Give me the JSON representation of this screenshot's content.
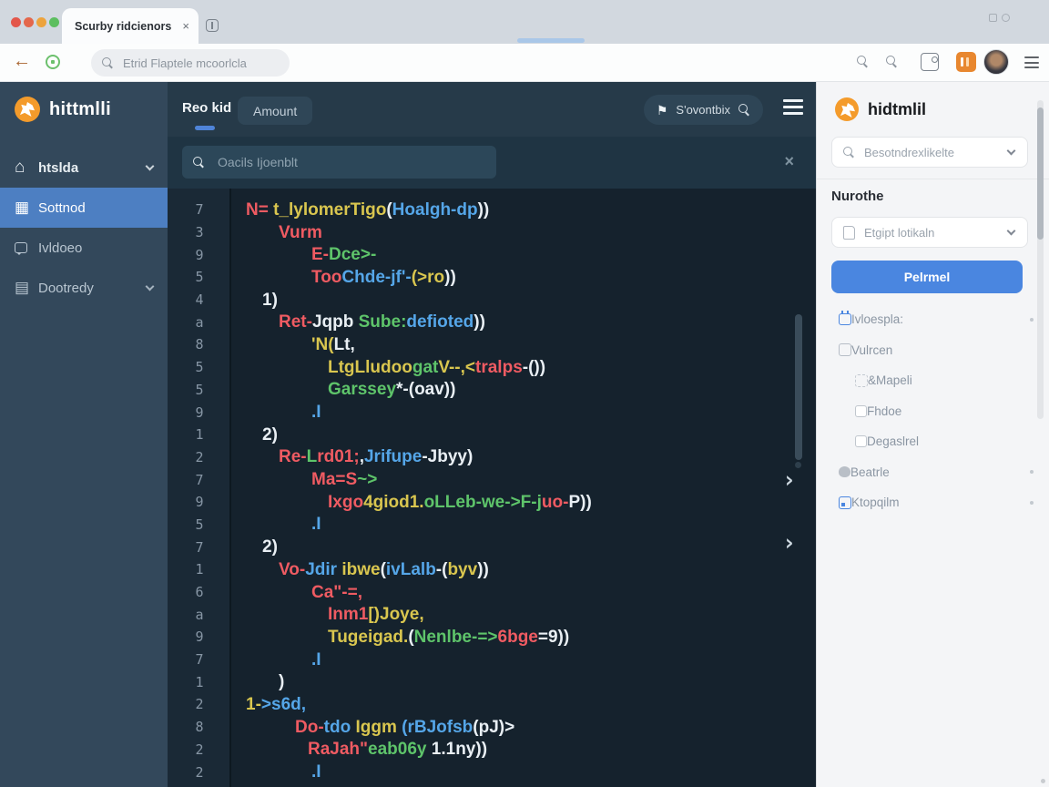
{
  "browser": {
    "tab_title": "Scurby ridcienors",
    "address_placeholder": "Etrid Flaptele mcoorlcla"
  },
  "sidebar": {
    "logo_text": "hittmlli",
    "items": [
      {
        "name": "home",
        "icon": "home",
        "label": "htslda",
        "chevron": true,
        "active": false
      },
      {
        "name": "dashboard",
        "icon": "grid",
        "label": "Sottnod",
        "chevron": false,
        "active": true
      },
      {
        "name": "videos",
        "icon": "chat",
        "label": "Ivldoeo",
        "chevron": false,
        "active": false
      },
      {
        "name": "library",
        "icon": "book",
        "label": "Dootredy",
        "chevron": true,
        "active": false
      }
    ]
  },
  "editor": {
    "active_tab": "Reo kid",
    "secondary_button": "Amount",
    "action_pill": "S'ovontbix",
    "search_placeholder": "Oacils Ijoenblt",
    "close_glyph": "×"
  },
  "code": {
    "lines": [
      {
        "n": "7",
        "i": 0,
        "s": [
          [
            "r",
            "N= "
          ],
          [
            "y",
            "t_lylomerTigo"
          ],
          [
            "w",
            "("
          ],
          [
            "b",
            "Hoalgh-dp"
          ],
          [
            "w",
            "))"
          ]
        ]
      },
      {
        "n": "3",
        "i": 36,
        "s": [
          [
            "r",
            "Vurm"
          ]
        ]
      },
      {
        "n": "9",
        "i": 72,
        "s": [
          [
            "r",
            "E-"
          ],
          [
            "g",
            "Dce>-"
          ]
        ]
      },
      {
        "n": "5",
        "i": 72,
        "s": [
          [
            "r",
            "Too"
          ],
          [
            "b",
            "Chde-jf'-"
          ],
          [
            "y",
            "(>ro"
          ],
          [
            "w",
            "))"
          ]
        ]
      },
      {
        "n": "4",
        "i": 18,
        "s": [
          [
            "w",
            "1)"
          ]
        ]
      },
      {
        "n": "a",
        "i": 36,
        "s": [
          [
            "r",
            "Ret-"
          ],
          [
            "w",
            "Jqpb "
          ],
          [
            "g",
            "Sube:"
          ],
          [
            "b",
            "defioted"
          ],
          [
            "w",
            "))"
          ]
        ]
      },
      {
        "n": "8",
        "i": 72,
        "s": [
          [
            "y",
            "'N("
          ],
          [
            "w",
            "Lt,"
          ]
        ]
      },
      {
        "n": "5",
        "i": 90,
        "s": [
          [
            "y",
            "LtgLludoo"
          ],
          [
            "g",
            "gat"
          ],
          [
            "y",
            "V--,<"
          ],
          [
            "r",
            "tralps"
          ],
          [
            "w",
            "-())"
          ]
        ]
      },
      {
        "n": "5",
        "i": 90,
        "s": [
          [
            "g",
            "Garssey"
          ],
          [
            "w",
            "*-(oav))"
          ]
        ]
      },
      {
        "n": "9",
        "i": 72,
        "s": [
          [
            "b",
            ".I"
          ]
        ]
      },
      {
        "n": "1",
        "i": 18,
        "s": [
          [
            "w",
            "2)"
          ]
        ]
      },
      {
        "n": "2",
        "i": 36,
        "s": [
          [
            "r",
            "Re-"
          ],
          [
            "g",
            "L"
          ],
          [
            "r",
            "rd01;"
          ],
          [
            "w",
            ","
          ],
          [
            "b",
            "Jrifupe"
          ],
          [
            "w",
            "-Jbyy)"
          ]
        ]
      },
      {
        "n": "7",
        "i": 72,
        "s": [
          [
            "r",
            "Ma=S"
          ],
          [
            "g",
            "~>"
          ]
        ]
      },
      {
        "n": "9",
        "i": 90,
        "s": [
          [
            "r",
            "Ixgo"
          ],
          [
            "y",
            "4giod1."
          ],
          [
            "g",
            "oLLeb-we->F-j"
          ],
          [
            "r",
            "uo-"
          ],
          [
            "w",
            "P))"
          ]
        ]
      },
      {
        "n": "5",
        "i": 72,
        "s": [
          [
            "b",
            ".I"
          ]
        ]
      },
      {
        "n": "7",
        "i": 18,
        "s": [
          [
            "w",
            "2)"
          ]
        ]
      },
      {
        "n": "1",
        "i": 36,
        "s": [
          [
            "r",
            "Vo-"
          ],
          [
            "b",
            "Jdir "
          ],
          [
            "y",
            "ibwe"
          ],
          [
            "w",
            "("
          ],
          [
            "b",
            "ivLalb"
          ],
          [
            "w",
            "-("
          ],
          [
            "y",
            "byv"
          ],
          [
            "w",
            "))"
          ]
        ]
      },
      {
        "n": "6",
        "i": 72,
        "s": [
          [
            "r",
            "Ca\"-=,"
          ]
        ]
      },
      {
        "n": "a",
        "i": 90,
        "s": [
          [
            "r",
            "Inm1"
          ],
          [
            "y",
            "[)Joye,"
          ]
        ]
      },
      {
        "n": "9",
        "i": 90,
        "s": [
          [
            "y",
            "Tugeigad."
          ],
          [
            "w",
            "("
          ],
          [
            "g",
            "Nenlbe-=>"
          ],
          [
            "r",
            "6bge"
          ],
          [
            "w",
            "=9))"
          ]
        ]
      },
      {
        "n": "7",
        "i": 72,
        "s": [
          [
            "b",
            ".I"
          ]
        ]
      },
      {
        "n": "1",
        "i": 36,
        "s": [
          [
            "w",
            ")"
          ]
        ]
      },
      {
        "n": "2",
        "i": 0,
        "s": [
          [
            "y",
            "1-"
          ],
          [
            "b",
            ">s6d,"
          ]
        ]
      },
      {
        "n": "8",
        "i": 54,
        "s": [
          [
            "r",
            "Do-"
          ],
          [
            "b",
            "tdo "
          ],
          [
            "y",
            "Iggm "
          ],
          [
            "b",
            "(rBJofsb"
          ],
          [
            "w",
            "(pJ)>"
          ]
        ]
      },
      {
        "n": "2",
        "i": 68,
        "s": [
          [
            "r",
            "RaJah\""
          ],
          [
            "g",
            "eab06y "
          ],
          [
            "w",
            "1.1ny))"
          ]
        ]
      },
      {
        "n": "2",
        "i": 72,
        "s": [
          [
            "b",
            ".I"
          ]
        ]
      }
    ]
  },
  "panel": {
    "logo_text": "hidtmlil",
    "search_placeholder": "Besotndrexlikelte",
    "section_label": "Nurothe",
    "dropdown_value": "Etgipt lotikaln",
    "primary_button": "Pelrmel",
    "items": [
      {
        "name": "templates",
        "icon": "cal",
        "label": "Ivloespla:",
        "indent": 0,
        "dot": true
      },
      {
        "name": "screen",
        "icon": "sq",
        "label": "Vulrcen",
        "indent": 0,
        "dot": false
      },
      {
        "name": "wrapper",
        "icon": "sqd",
        "label": "&Mapeli",
        "indent": 1,
        "dot": false
      },
      {
        "name": "shadow",
        "icon": "chk",
        "label": "Fhdoe",
        "indent": 1,
        "dot": false
      },
      {
        "name": "details",
        "icon": "chk",
        "label": "Degaslrel",
        "indent": 1,
        "dot": false
      },
      {
        "name": "beastie",
        "icon": "blob",
        "label": "Beatrle",
        "indent": 0,
        "dot": true
      },
      {
        "name": "dropdown",
        "icon": "sqb",
        "label": "Ktopqilm",
        "indent": 0,
        "dot": true
      }
    ]
  },
  "colors": {
    "accent_blue": "#4a86e0",
    "sidebar_active": "#4d7fc2",
    "logo_orange": "#f49b2b",
    "code_tokens": {
      "r": "#ef5b62",
      "y": "#d9c64f",
      "g": "#5ec46a",
      "b": "#55a6e8",
      "w": "#e9eff4"
    }
  }
}
